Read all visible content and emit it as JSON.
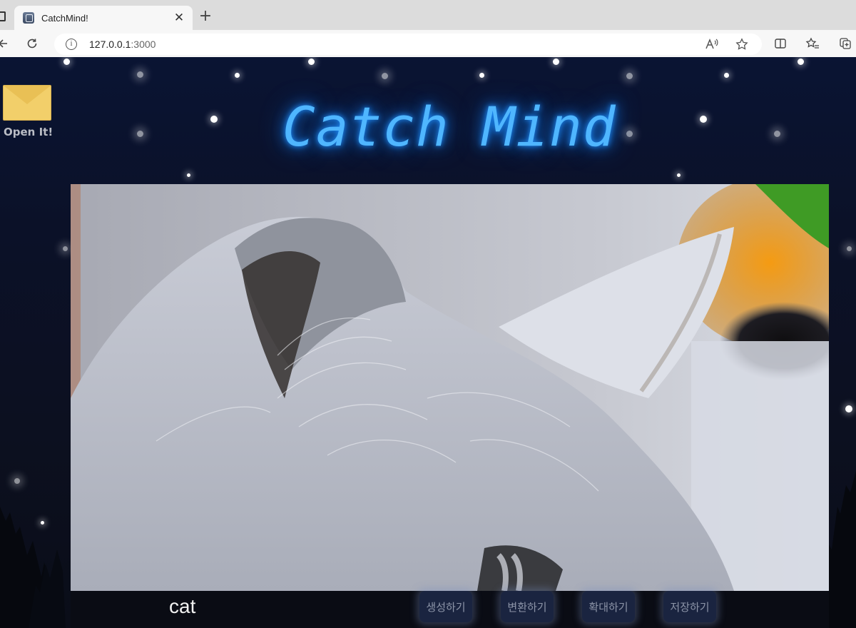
{
  "browser": {
    "tab_title": "CatchMind!",
    "tab_close": "✕",
    "new_tab": "+",
    "url_host": "127.0.0.1",
    "url_port": ":3000"
  },
  "page": {
    "mail": {
      "label": "Open It!"
    },
    "title": "Catch Mind",
    "prompt": "cat",
    "buttons": {
      "generate": "생성하기",
      "convert": "변환하기",
      "zoom": "확대하기",
      "save": "저장하기"
    }
  },
  "colors": {
    "title_glow": "#4fb6ff",
    "background": "#0b1128",
    "button_bg": "#1a2440"
  }
}
